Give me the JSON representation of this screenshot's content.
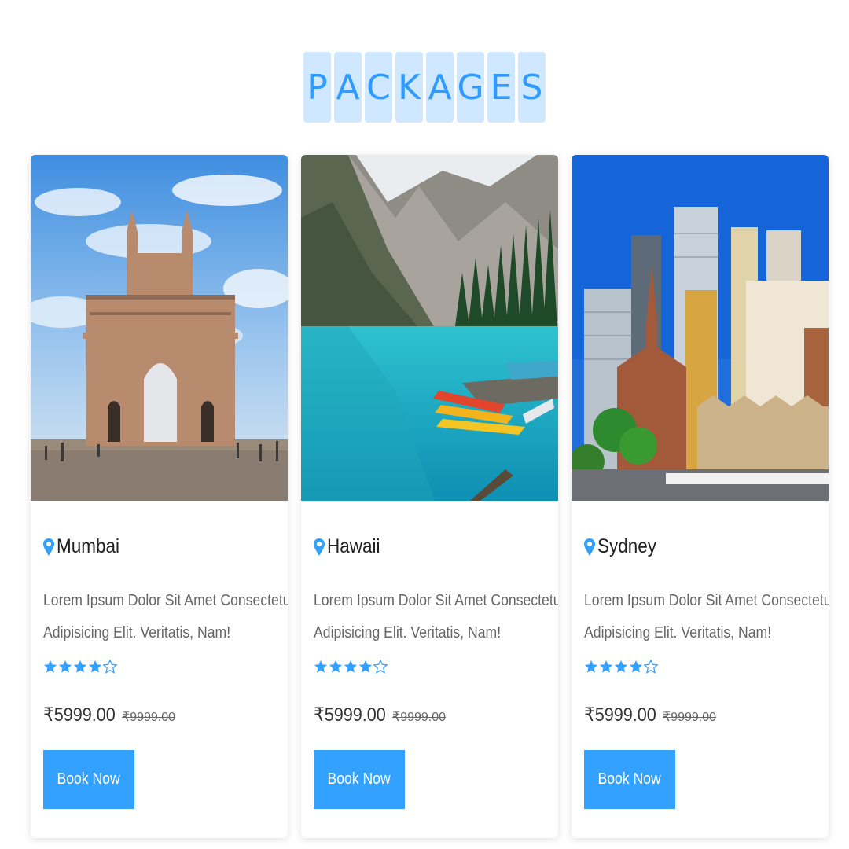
{
  "section": {
    "title_letters": [
      "P",
      "A",
      "C",
      "K",
      "A",
      "G",
      "E",
      "S"
    ]
  },
  "colors": {
    "accent": "#33a1ff",
    "heading_bg": "#cfe7ff",
    "heading_text": "#2f9bff"
  },
  "packages": [
    {
      "location": "Mumbai",
      "image_subject": "Gateway of India monument under blue sky",
      "description_line1": "Lorem Ipsum Dolor Sit Amet Consectetur",
      "description_line2": "Adipisicing Elit. Veritatis, Nam!",
      "rating": 4,
      "rating_max": 5,
      "price": "₹5999.00",
      "old_price": "₹9999.00",
      "button_label": "Book Now"
    },
    {
      "location": "Hawaii",
      "image_subject": "Turquoise mountain lake with canoes",
      "description_line1": "Lorem Ipsum Dolor Sit Amet Consectetur",
      "description_line2": "Adipisicing Elit. Veritatis, Nam!",
      "rating": 4,
      "rating_max": 5,
      "price": "₹5999.00",
      "old_price": "₹9999.00",
      "button_label": "Book Now"
    },
    {
      "location": "Sydney",
      "image_subject": "City skyline with historic brick buildings",
      "description_line1": "Lorem Ipsum Dolor Sit Amet Consectetur",
      "description_line2": "Adipisicing Elit. Veritatis, Nam!",
      "rating": 4,
      "rating_max": 5,
      "price": "₹5999.00",
      "old_price": "₹9999.00",
      "button_label": "Book Now"
    }
  ],
  "icons": {
    "location": "map-pin-icon",
    "star_filled": "star-filled-icon",
    "star_empty": "star-outline-icon"
  }
}
